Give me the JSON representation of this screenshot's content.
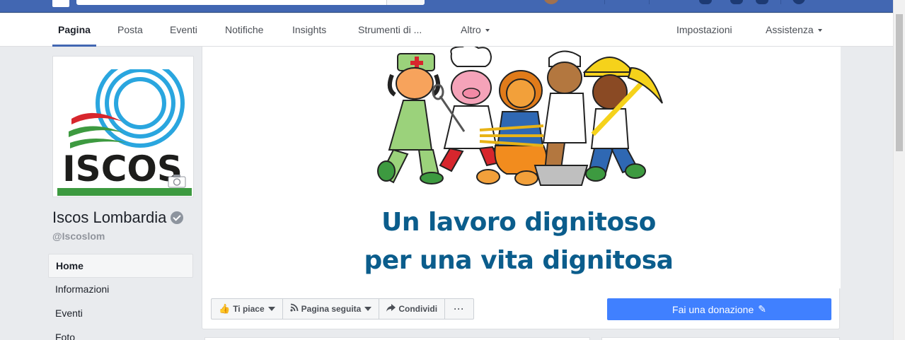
{
  "nav": {
    "tabs": [
      {
        "label": "Pagina"
      },
      {
        "label": "Posta"
      },
      {
        "label": "Eventi"
      },
      {
        "label": "Notifiche"
      },
      {
        "label": "Insights"
      },
      {
        "label": "Strumenti di ..."
      },
      {
        "label": "Altro"
      }
    ],
    "right": [
      {
        "label": "Impostazioni"
      },
      {
        "label": "Assistenza"
      }
    ]
  },
  "profile": {
    "logo_text": "ISCOS",
    "name": "Iscos Lombardia",
    "handle": "@Iscoslom"
  },
  "leftnav": {
    "items": [
      {
        "label": "Home"
      },
      {
        "label": "Informazioni"
      },
      {
        "label": "Eventi"
      },
      {
        "label": "Foto"
      }
    ]
  },
  "cover": {
    "line1": "Un lavoro dignitoso",
    "line2": "per una vita dignitosa"
  },
  "actions": {
    "like": "Ti piace",
    "follow": "Pagina seguita",
    "share": "Condividi",
    "more": "···",
    "donate": "Fai una donazione"
  },
  "colors": {
    "brand_blue": "#4267b2",
    "donate_blue": "#4080ff",
    "tagline": "#0b5d8c",
    "logo_cyan": "#2aa6df"
  }
}
